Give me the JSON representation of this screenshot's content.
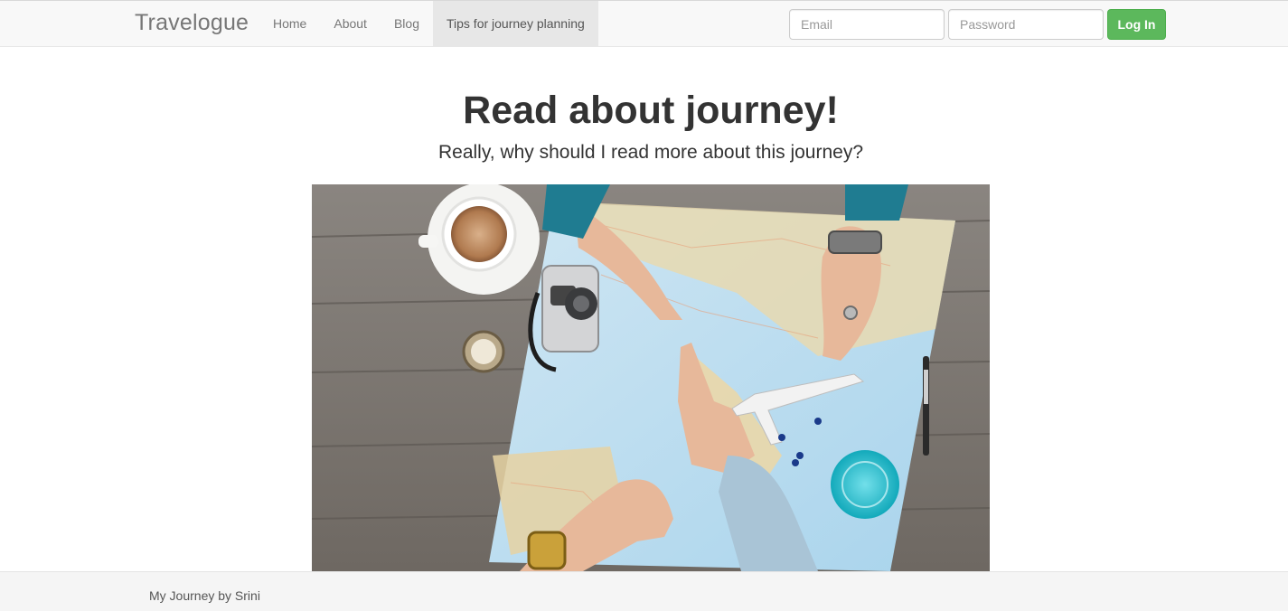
{
  "navbar": {
    "brand": "Travelogue",
    "links": [
      {
        "label": "Home"
      },
      {
        "label": "About"
      },
      {
        "label": "Blog"
      },
      {
        "label": "Tips for journey planning",
        "active": true
      }
    ]
  },
  "login": {
    "email_placeholder": "Email",
    "password_placeholder": "Password",
    "button_label": "Log In",
    "button_color": "#5cb85c"
  },
  "hero": {
    "title": "Read about journey!",
    "subtitle": "Really, why should I read more about this journey?"
  },
  "footer": {
    "text": "My Journey by Srini"
  }
}
